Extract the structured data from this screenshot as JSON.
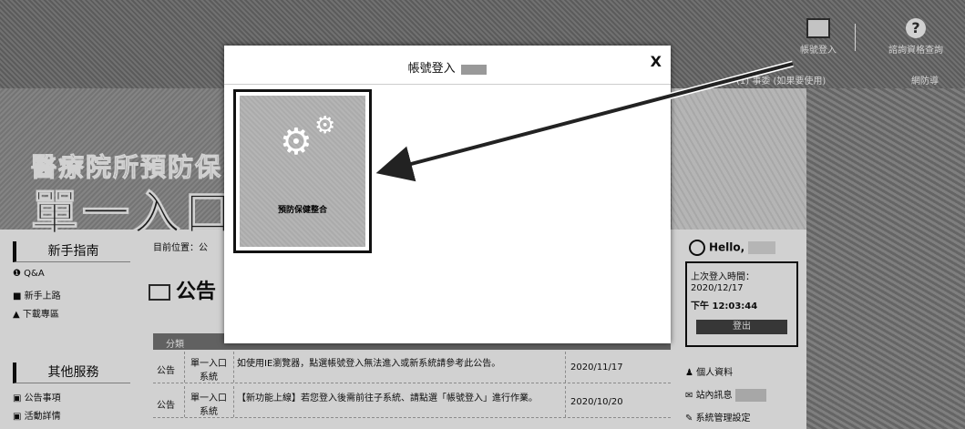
{
  "header": {
    "login_label": "帳號登入",
    "help_label": "諮詢資格查詢",
    "subnav_1": "(1) 事委 (如果要使用)",
    "subnav_2": "網防導",
    "login_icon": "id-card-icon",
    "help_icon": "question-icon"
  },
  "hero": {
    "title_line1": "醫療院所預防保",
    "title_line2": "單一入口系"
  },
  "sidebar": {
    "guide_title": "新手指南",
    "guide_items": [
      "Q&A",
      "新手上路",
      "下載專區"
    ],
    "other_title": "其他服務",
    "other_items": [
      "公告事項",
      "活動詳情"
    ]
  },
  "content": {
    "breadcrumb": "目前位置：公",
    "notice_title": "公告",
    "table_header": "分類",
    "rows": [
      {
        "category": "公告",
        "system": "單一入口系統",
        "title": "如使用IE瀏覽器，點選帳號登入無法進入或新系統請參考此公告。",
        "date": "2020/11/17"
      },
      {
        "category": "公告",
        "system": "單一入口系統",
        "title": "【新功能上線】若您登入後需前往子系統、請點選「帳號登入」進行作業。",
        "date": "2020/10/20"
      }
    ]
  },
  "user": {
    "hello": "Hello,",
    "last_login_label": "上次登入時間：",
    "last_login_date": "2020/12/17",
    "last_login_time": "下午 12:03:44",
    "logout": "登出",
    "links": [
      "個人資料",
      "站內訊息",
      "系統管理設定"
    ]
  },
  "modal": {
    "title": "帳號登入",
    "badge": "",
    "close": "X",
    "tile_label": "預防保健整合"
  },
  "colors": {
    "header_bg": "#7d7d7d",
    "logout_bg": "#444444"
  }
}
